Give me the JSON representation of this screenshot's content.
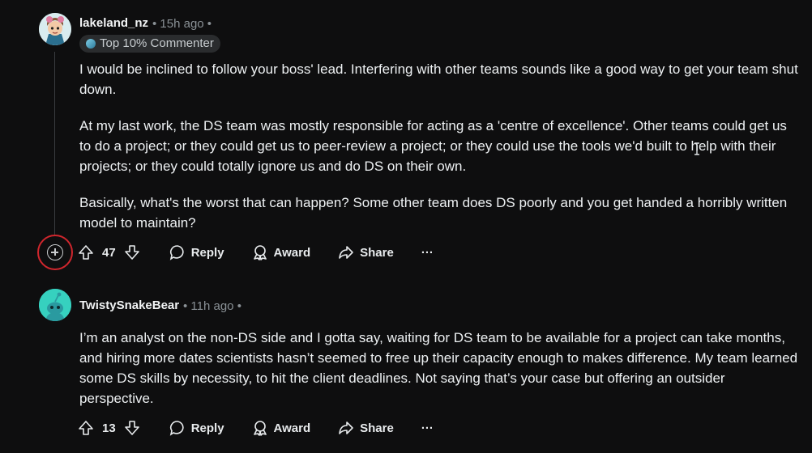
{
  "comments": [
    {
      "author": "lakeland_nz",
      "meta": "• 15h ago •",
      "flair": "Top 10% Commenter",
      "paragraphs": [
        "I would be inclined to follow your boss' lead. Interfering with other teams sounds like a good way to get your team shut down.",
        "At my last work, the DS team was mostly responsible for acting as a 'centre of excellence'. Other teams could get us to do a project; or they could get us to peer-review a project; or they could use the tools we'd built to help with their projects; or they could totally ignore us and do DS on their own.",
        "Basically, what's the worst that can happen? Some other team does DS poorly and you get handed a horribly written model to maintain?"
      ],
      "votes": "47",
      "reply": "Reply",
      "award": "Award",
      "share": "Share",
      "more": "···"
    },
    {
      "author": "TwistySnakeBear",
      "meta": "• 11h ago •",
      "paragraphs": [
        "I’m an analyst on the non-DS side and I gotta say, waiting for DS team to be available for a project can take months, and hiring more dates scientists hasn’t seemed to free up their capacity enough to makes difference. My team learned some DS skills by necessity, to hit the client deadlines. Not saying that’s your case but offering an outsider perspective."
      ],
      "votes": "13",
      "reply": "Reply",
      "award": "Award",
      "share": "Share",
      "more": "···"
    }
  ],
  "icons": {
    "upvote": "arrow-up-icon",
    "downvote": "arrow-down-icon",
    "reply": "speech-bubble-icon",
    "award": "award-icon",
    "share": "share-arrow-icon",
    "expand": "plus-circle-icon"
  },
  "colors": {
    "background": "#0e0e0f",
    "text": "#eef1f3",
    "muted": "#8a9196",
    "highlight": "#d0262d"
  }
}
